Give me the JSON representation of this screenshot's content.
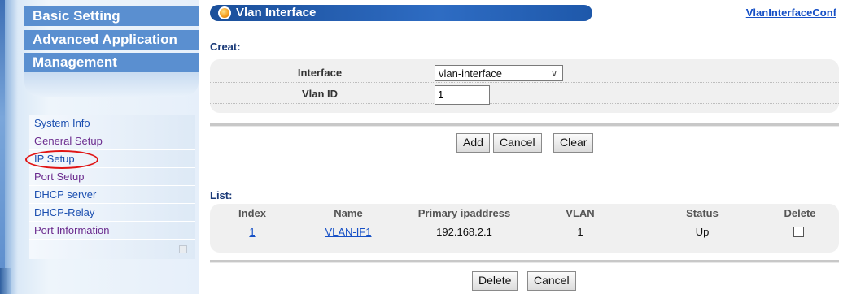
{
  "sidebar": {
    "top_menu": [
      "Basic Setting",
      "Advanced Application",
      "Management"
    ],
    "sub_items": [
      {
        "label": "System Info"
      },
      {
        "label": "General Setup"
      },
      {
        "label": "IP Setup"
      },
      {
        "label": "Port Setup"
      },
      {
        "label": "DHCP server"
      },
      {
        "label": "DHCP-Relay"
      },
      {
        "label": "Port Information"
      }
    ]
  },
  "header": {
    "title": "Vlan Interface",
    "link": "VlanInterfaceConf"
  },
  "creat": {
    "section_label": "Creat:",
    "interface_label": "Interface",
    "interface_value": "vlan-interface",
    "vlan_id_label": "Vlan ID",
    "vlan_id_value": "1",
    "buttons": {
      "add": "Add",
      "cancel": "Cancel",
      "clear": "Clear"
    }
  },
  "list": {
    "section_label": "List:",
    "columns": [
      "Index",
      "Name",
      "Primary ipaddress",
      "VLAN",
      "Status",
      "Delete"
    ],
    "rows": [
      {
        "index": "1",
        "name": "VLAN-IF1",
        "ip": "192.168.2.1",
        "vlan": "1",
        "status": "Up",
        "delete_checked": false
      }
    ],
    "buttons": {
      "delete": "Delete",
      "cancel": "Cancel"
    }
  },
  "colors": {
    "title_bar": "#2e6cc3",
    "menu_text": "#ffffff",
    "link": "#1650c6",
    "highlight_ring": "#e01414"
  }
}
